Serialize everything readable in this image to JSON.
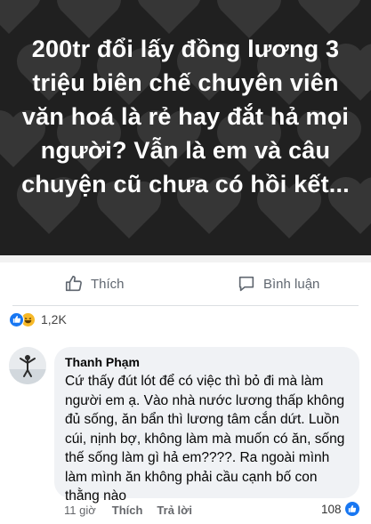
{
  "post": {
    "text": "200tr đổi lấy đồng lương 3 triệu biên chế chuyên viên văn hoá là rẻ hay đắt hả mọi người? Vẫn là em và câu chuyện cũ chưa có hồi kết...",
    "background_color": "#202020",
    "pattern": "heart-icon"
  },
  "actions": {
    "like_label": "Thích",
    "comment_label": "Bình luận"
  },
  "reactions": {
    "count": "1,2K",
    "types": [
      "like-icon",
      "haha-icon"
    ]
  },
  "comment": {
    "author": "Thanh Phạm",
    "text": "Cứ thấy đút lót để có việc thì bỏ đi mà làm người em ạ. Vào nhà nước lương thấp không đủ sống, ăn bẩn thì lương tâm cắn dứt. Luồn cúi, nịnh bợ, không làm mà muốn có ăn, sống thế sống làm gì hả em????. Ra ngoài mình làm mình ăn không phải cầu cạnh bố con thằng nào",
    "time": "11 giờ",
    "like_label": "Thích",
    "reply_label": "Trả lời",
    "like_count": "108"
  },
  "colors": {
    "accent": "#1877f2",
    "haha": "#f7b928",
    "bubble": "#f0f2f5"
  }
}
